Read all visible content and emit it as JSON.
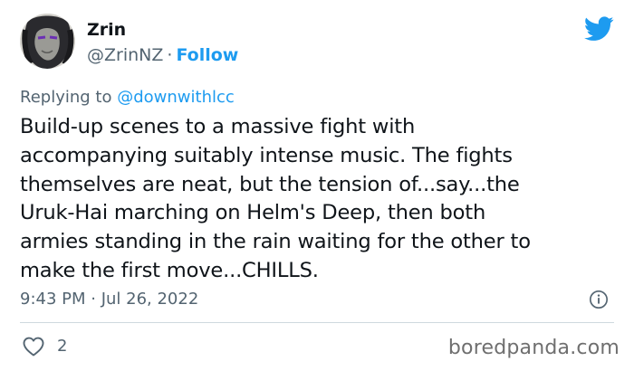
{
  "tweet": {
    "author_name": "Zrin",
    "author_handle": "@ZrinNZ",
    "separator": "·",
    "follow_label": "Follow",
    "replying_prefix": "Replying to",
    "replying_handle": "@downwithlcc",
    "text_lines": [
      "Build-up scenes to a massive fight with",
      "accompanying suitably intense music. The fights",
      "themselves are neat, but the tension of...say...the",
      "Uruk-Hai marching on Helm's Deep, then both",
      "armies standing in the rain waiting for the other to",
      "make the first move...CHILLS."
    ],
    "timestamp": "9:43 PM · Jul 26, 2022",
    "like_count": "2"
  },
  "icons": {
    "brand": "twitter-bird-icon",
    "info": "info-icon",
    "like": "heart-icon"
  },
  "colors": {
    "accent": "#1d9bf0",
    "text_primary": "#0f1419",
    "text_secondary": "#536471",
    "divider": "#cfd9de"
  },
  "watermark": "boredpanda.com"
}
